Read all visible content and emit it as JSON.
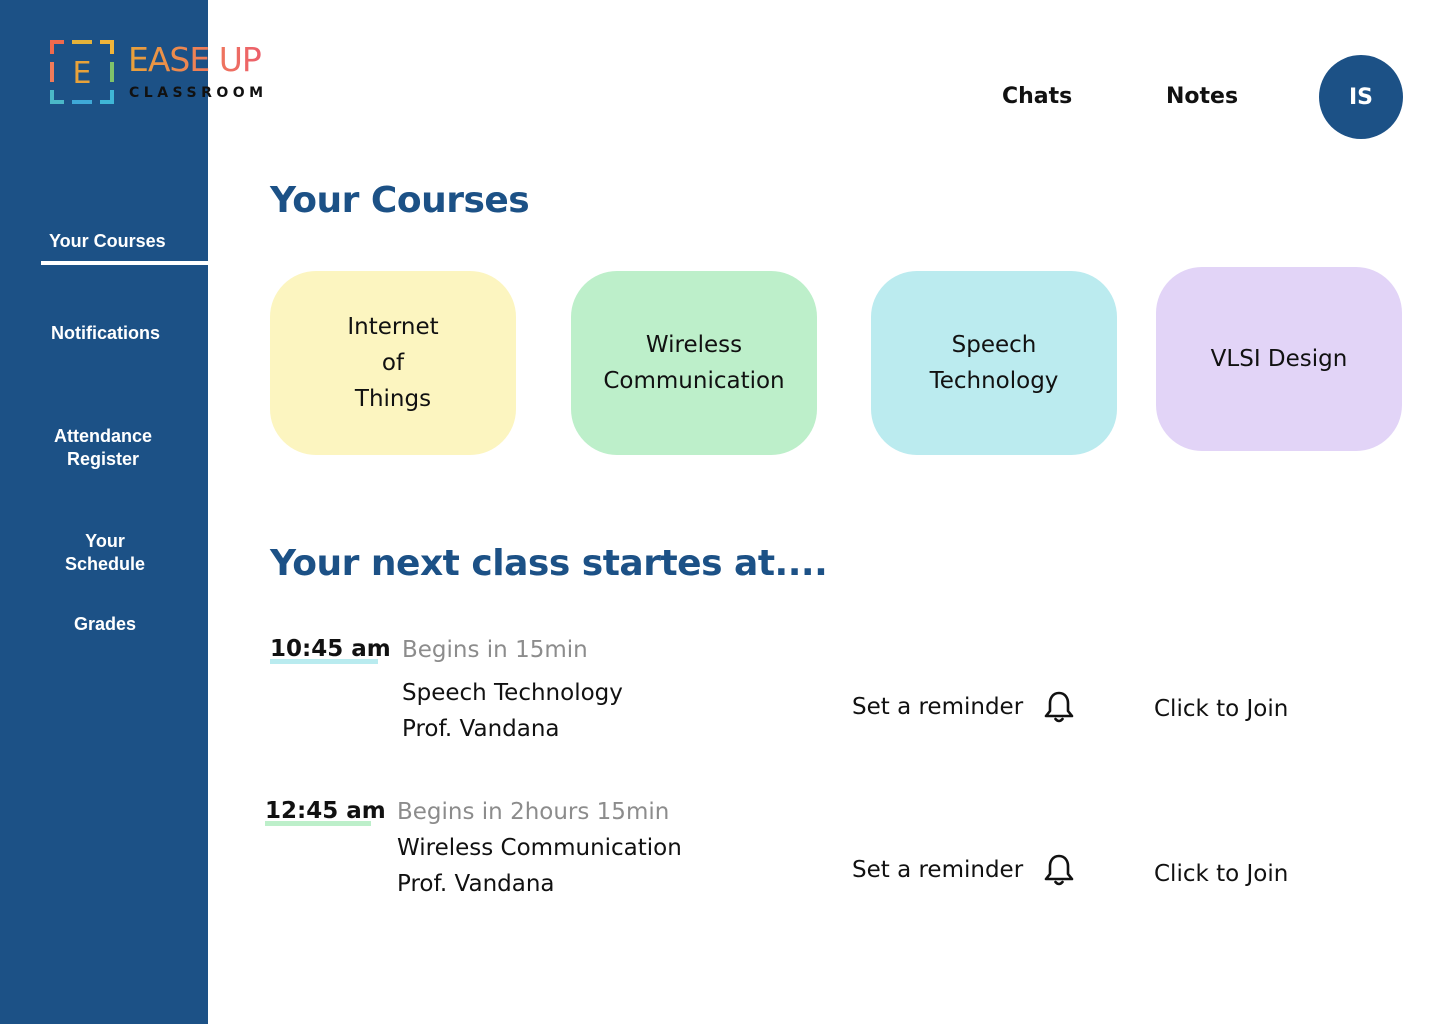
{
  "brand": {
    "title": "EASE UP",
    "subtitle": "CLASSROOM",
    "mark_letter": "E"
  },
  "sidebar": {
    "items": [
      {
        "label": "Your Courses",
        "active": true
      },
      {
        "label": "Notifications",
        "active": false
      },
      {
        "label": "Attendance\nRegister",
        "active": false
      },
      {
        "label": "Your\nSchedule",
        "active": false
      },
      {
        "label": "Grades",
        "active": false
      }
    ]
  },
  "header": {
    "chats_label": "Chats",
    "notes_label": "Notes",
    "avatar_initials": "IS"
  },
  "courses": {
    "title": "Your Courses",
    "cards": [
      {
        "label": "Internet\nof\nThings",
        "color": "#fcf5c0"
      },
      {
        "label": "Wireless\nCommunication",
        "color": "#bdefca"
      },
      {
        "label": "Speech\nTechnology",
        "color": "#bbebef"
      },
      {
        "label": "VLSI Design",
        "color": "#e2d4f7"
      }
    ]
  },
  "next_class": {
    "title": "Your next class startes at....",
    "reminder_label": "Set a reminder",
    "join_label": "Click to Join",
    "items": [
      {
        "time": "10:45 am",
        "begins": "Begins in 15min",
        "course": "Speech Technology",
        "professor": "Prof. Vandana",
        "underline_color": "#b9ebef"
      },
      {
        "time": "12:45 am",
        "begins": "Begins in 2hours 15min",
        "course": "Wireless Communication",
        "professor": "Prof. Vandana",
        "underline_color": "#bdefca"
      }
    ]
  },
  "colors": {
    "primary": "#1c5186",
    "muted_text": "#8c8c8c"
  }
}
